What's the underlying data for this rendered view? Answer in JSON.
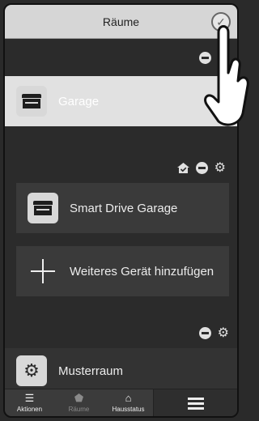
{
  "header": {
    "title": "Räume",
    "done_icon": "check-circle-icon"
  },
  "rooms": [
    {
      "label": "Garage",
      "icon": "garage-icon",
      "selected": true
    },
    {
      "label": "Musterraum",
      "icon": "gear-icon",
      "selected": false
    }
  ],
  "devices": [
    {
      "label": "Smart Drive Garage",
      "icon": "garage-icon"
    }
  ],
  "add_device": {
    "label": "Weiteres Gerät hinzufügen",
    "icon": "plus-icon"
  },
  "tabs": [
    {
      "label": "Aktionen",
      "icon": "list-icon",
      "active": true
    },
    {
      "label": "Räume",
      "icon": "shield-icon",
      "active": false
    },
    {
      "label": "Hausstatus",
      "icon": "house-check-icon",
      "active": true
    }
  ],
  "menu": {
    "icon": "hamburger-icon"
  }
}
